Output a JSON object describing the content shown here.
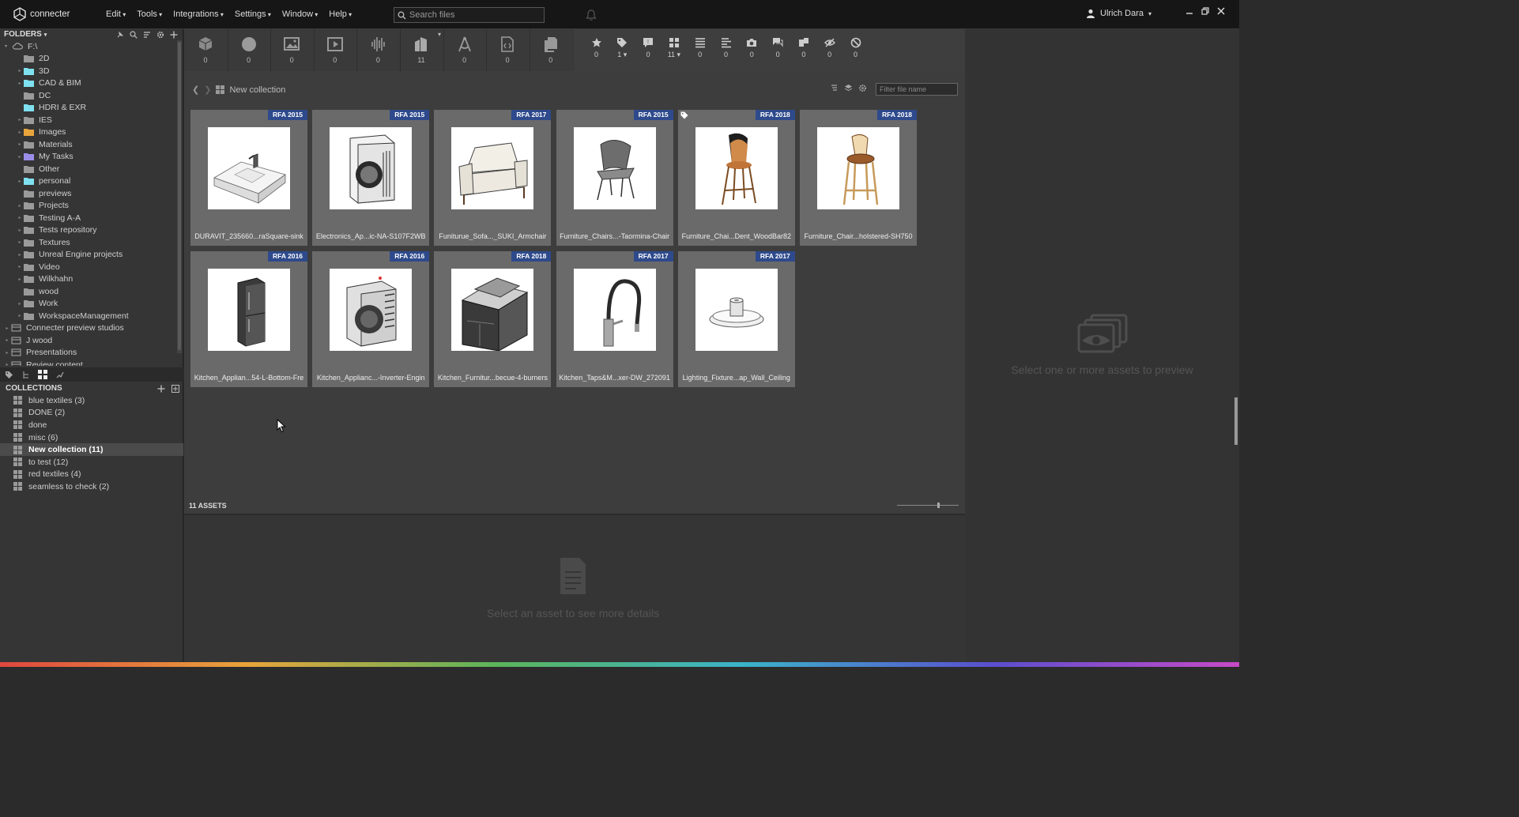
{
  "app": {
    "name": "connecter"
  },
  "menu": [
    {
      "label": "Edit"
    },
    {
      "label": "Tools"
    },
    {
      "label": "Integrations"
    },
    {
      "label": "Settings"
    },
    {
      "label": "Window"
    },
    {
      "label": "Help"
    }
  ],
  "search": {
    "placeholder": "Search files"
  },
  "user": {
    "name": "Ulrich Dara"
  },
  "folders": {
    "header": "FOLDERS",
    "root": "F:\\",
    "items": [
      {
        "label": "2D",
        "color": "#9a9a9a",
        "arrow": "",
        "indent": 1
      },
      {
        "label": "3D",
        "color": "#7fe0f0",
        "arrow": "▸",
        "indent": 1
      },
      {
        "label": "CAD & BIM",
        "color": "#7fe0f0",
        "arrow": "▸",
        "indent": 1
      },
      {
        "label": "DC",
        "color": "#9a9a9a",
        "arrow": "",
        "indent": 1
      },
      {
        "label": "HDRI & EXR",
        "color": "#7fe0f0",
        "arrow": "",
        "indent": 1
      },
      {
        "label": "IES",
        "color": "#9a9a9a",
        "arrow": "▸",
        "indent": 1
      },
      {
        "label": "Images",
        "color": "#e8a43b",
        "arrow": "▸",
        "indent": 1
      },
      {
        "label": "Materials",
        "color": "#9a9a9a",
        "arrow": "▸",
        "indent": 1
      },
      {
        "label": "My Tasks",
        "color": "#9b8ee8",
        "arrow": "▸",
        "indent": 1
      },
      {
        "label": "Other",
        "color": "#9a9a9a",
        "arrow": "",
        "indent": 1
      },
      {
        "label": "personal",
        "color": "#7fe0f0",
        "arrow": "▸",
        "indent": 1
      },
      {
        "label": "previews",
        "color": "#9a9a9a",
        "arrow": "",
        "indent": 1
      },
      {
        "label": "Projects",
        "color": "#9a9a9a",
        "arrow": "▸",
        "indent": 1
      },
      {
        "label": "Testing A-A",
        "color": "#9a9a9a",
        "arrow": "▸",
        "indent": 1
      },
      {
        "label": "Tests repository",
        "color": "#9a9a9a",
        "arrow": "▸",
        "indent": 1
      },
      {
        "label": "Textures",
        "color": "#9a9a9a",
        "arrow": "▸",
        "indent": 1
      },
      {
        "label": "Unreal Engine projects",
        "color": "#9a9a9a",
        "arrow": "▸",
        "indent": 1
      },
      {
        "label": "Video",
        "color": "#9a9a9a",
        "arrow": "▸",
        "indent": 1
      },
      {
        "label": "Wilkhahn",
        "color": "#9a9a9a",
        "arrow": "▸",
        "indent": 1
      },
      {
        "label": "wood",
        "color": "#9a9a9a",
        "arrow": "",
        "indent": 1
      },
      {
        "label": "Work",
        "color": "#9a9a9a",
        "arrow": "▸",
        "indent": 1
      },
      {
        "label": "WorkspaceManagement",
        "color": "#9a9a9a",
        "arrow": "▸",
        "indent": 1
      },
      {
        "label": "Connecter preview studios",
        "color": "#9a9a9a",
        "arrow": "▸",
        "indent": 0
      },
      {
        "label": "J wood",
        "color": "#9a9a9a",
        "arrow": "▸",
        "indent": 0
      },
      {
        "label": "Presentations",
        "color": "#9a9a9a",
        "arrow": "▸",
        "indent": 0
      },
      {
        "label": "Review content",
        "color": "#9a9a9a",
        "arrow": "▸",
        "indent": 0
      }
    ]
  },
  "collections": {
    "header": "COLLECTIONS",
    "items": [
      {
        "label": "blue textiles  (3)",
        "selected": false
      },
      {
        "label": "DONE  (2)",
        "selected": false
      },
      {
        "label": "done",
        "selected": false
      },
      {
        "label": "misc  (6)",
        "selected": false
      },
      {
        "label": "New collection  (11)",
        "selected": true
      },
      {
        "label": "to test  (12)",
        "selected": false
      },
      {
        "label": "red textiles  (4)",
        "selected": false
      },
      {
        "label": "seamless to check  (2)",
        "selected": false
      }
    ]
  },
  "type_filters": [
    {
      "icon": "cube-icon",
      "count": "0"
    },
    {
      "icon": "sphere-icon",
      "count": "0"
    },
    {
      "icon": "image-icon",
      "count": "0"
    },
    {
      "icon": "video-icon",
      "count": "0"
    },
    {
      "icon": "audio-icon",
      "count": "0"
    },
    {
      "icon": "building-icon",
      "count": "11"
    },
    {
      "icon": "drafting-icon",
      "count": "0"
    },
    {
      "icon": "code-file-icon",
      "count": "0"
    },
    {
      "icon": "documents-icon",
      "count": "0"
    }
  ],
  "meta_filters": [
    {
      "icon": "star-icon",
      "count": "0"
    },
    {
      "icon": "tag-icon",
      "count": "1 ▾"
    },
    {
      "icon": "comment-flag-icon",
      "count": "0"
    },
    {
      "icon": "grid-icon",
      "count": "11 ▾"
    },
    {
      "icon": "list-icon",
      "count": "0"
    },
    {
      "icon": "align-icon",
      "count": "0"
    },
    {
      "icon": "camera-icon",
      "count": "0"
    },
    {
      "icon": "chat-icon",
      "count": "0"
    },
    {
      "icon": "pages-icon",
      "count": "0"
    },
    {
      "icon": "hidden-icon",
      "count": "0"
    },
    {
      "icon": "blocked-icon",
      "count": "0"
    }
  ],
  "breadcrumb": {
    "current": "New collection"
  },
  "filter": {
    "placeholder": "Filter file name"
  },
  "assets": [
    {
      "name": "DURAVIT_235660...raSquare-sink",
      "badge": "RFA 2015",
      "kind": "sink",
      "tagged": false
    },
    {
      "name": "Electronics_Ap...ic-NA-S107F2WB",
      "badge": "RFA 2015",
      "kind": "washer",
      "tagged": false
    },
    {
      "name": "Funiturue_Sofa..._SUKI_Armchair",
      "badge": "RFA 2017",
      "kind": "armchair",
      "tagged": false
    },
    {
      "name": "Furniture_Chairs...-Taormina-Chair",
      "badge": "RFA 2015",
      "kind": "chair",
      "tagged": false
    },
    {
      "name": "Furniture_Chai...Dent_WoodBar82",
      "badge": "RFA 2018",
      "kind": "barstool-wood",
      "tagged": true
    },
    {
      "name": "Furniture_Chair...holstered-SH750",
      "badge": "RFA 2018",
      "kind": "barstool",
      "tagged": false
    },
    {
      "name": "Kitchen_Applian...54-L-Bottom-Fre",
      "badge": "RFA 2016",
      "kind": "fridge",
      "tagged": false
    },
    {
      "name": "Kitchen_Applianc...-Inverter-Engin",
      "badge": "RFA 2016",
      "kind": "washer2",
      "tagged": false
    },
    {
      "name": "Kitchen_Furnitur...becue-4-burners",
      "badge": "RFA 2018",
      "kind": "bbq",
      "tagged": false
    },
    {
      "name": "Kitchen_Taps&M...xer-DW_272091",
      "badge": "RFA 2017",
      "kind": "tap",
      "tagged": false
    },
    {
      "name": "Lighting_Fixture...ap_Wall_Ceiling",
      "badge": "RFA 2017",
      "kind": "lamp",
      "tagged": false
    }
  ],
  "status": {
    "count": "11 ASSETS",
    "zoom_fraction": 0.67
  },
  "details": {
    "message": "Select an asset to see more details"
  },
  "preview": {
    "message": "Select one or more assets to preview"
  }
}
